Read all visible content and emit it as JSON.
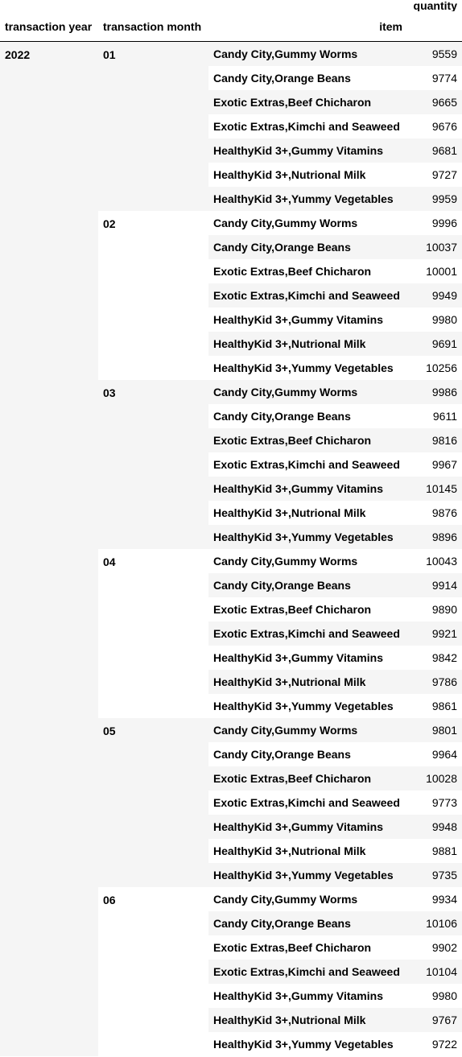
{
  "table": {
    "headers": {
      "transaction_year": "transaction year",
      "transaction_month": "transaction month",
      "item": "item",
      "quantity": "quantity"
    },
    "year": "2022",
    "months": [
      {
        "month": "01",
        "rows": [
          {
            "item": "Candy City,Gummy Worms",
            "quantity": "9559"
          },
          {
            "item": "Candy City,Orange Beans",
            "quantity": "9774"
          },
          {
            "item": "Exotic Extras,Beef Chicharon",
            "quantity": "9665"
          },
          {
            "item": "Exotic Extras,Kimchi and Seaweed",
            "quantity": "9676"
          },
          {
            "item": "HealthyKid 3+,Gummy Vitamins",
            "quantity": "9681"
          },
          {
            "item": "HealthyKid 3+,Nutrional Milk",
            "quantity": "9727"
          },
          {
            "item": "HealthyKid 3+,Yummy Vegetables",
            "quantity": "9959"
          }
        ]
      },
      {
        "month": "02",
        "rows": [
          {
            "item": "Candy City,Gummy Worms",
            "quantity": "9996"
          },
          {
            "item": "Candy City,Orange Beans",
            "quantity": "10037"
          },
          {
            "item": "Exotic Extras,Beef Chicharon",
            "quantity": "10001"
          },
          {
            "item": "Exotic Extras,Kimchi and Seaweed",
            "quantity": "9949"
          },
          {
            "item": "HealthyKid 3+,Gummy Vitamins",
            "quantity": "9980"
          },
          {
            "item": "HealthyKid 3+,Nutrional Milk",
            "quantity": "9691"
          },
          {
            "item": "HealthyKid 3+,Yummy Vegetables",
            "quantity": "10256"
          }
        ]
      },
      {
        "month": "03",
        "rows": [
          {
            "item": "Candy City,Gummy Worms",
            "quantity": "9986"
          },
          {
            "item": "Candy City,Orange Beans",
            "quantity": "9611"
          },
          {
            "item": "Exotic Extras,Beef Chicharon",
            "quantity": "9816"
          },
          {
            "item": "Exotic Extras,Kimchi and Seaweed",
            "quantity": "9967"
          },
          {
            "item": "HealthyKid 3+,Gummy Vitamins",
            "quantity": "10145"
          },
          {
            "item": "HealthyKid 3+,Nutrional Milk",
            "quantity": "9876"
          },
          {
            "item": "HealthyKid 3+,Yummy Vegetables",
            "quantity": "9896"
          }
        ]
      },
      {
        "month": "04",
        "rows": [
          {
            "item": "Candy City,Gummy Worms",
            "quantity": "10043"
          },
          {
            "item": "Candy City,Orange Beans",
            "quantity": "9914"
          },
          {
            "item": "Exotic Extras,Beef Chicharon",
            "quantity": "9890"
          },
          {
            "item": "Exotic Extras,Kimchi and Seaweed",
            "quantity": "9921"
          },
          {
            "item": "HealthyKid 3+,Gummy Vitamins",
            "quantity": "9842"
          },
          {
            "item": "HealthyKid 3+,Nutrional Milk",
            "quantity": "9786"
          },
          {
            "item": "HealthyKid 3+,Yummy Vegetables",
            "quantity": "9861"
          }
        ]
      },
      {
        "month": "05",
        "rows": [
          {
            "item": "Candy City,Gummy Worms",
            "quantity": "9801"
          },
          {
            "item": "Candy City,Orange Beans",
            "quantity": "9964"
          },
          {
            "item": "Exotic Extras,Beef Chicharon",
            "quantity": "10028"
          },
          {
            "item": "Exotic Extras,Kimchi and Seaweed",
            "quantity": "9773"
          },
          {
            "item": "HealthyKid 3+,Gummy Vitamins",
            "quantity": "9948"
          },
          {
            "item": "HealthyKid 3+,Nutrional Milk",
            "quantity": "9881"
          },
          {
            "item": "HealthyKid 3+,Yummy Vegetables",
            "quantity": "9735"
          }
        ]
      },
      {
        "month": "06",
        "rows": [
          {
            "item": "Candy City,Gummy Worms",
            "quantity": "9934"
          },
          {
            "item": "Candy City,Orange Beans",
            "quantity": "10106"
          },
          {
            "item": "Exotic Extras,Beef Chicharon",
            "quantity": "9902"
          },
          {
            "item": "Exotic Extras,Kimchi and Seaweed",
            "quantity": "10104"
          },
          {
            "item": "HealthyKid 3+,Gummy Vitamins",
            "quantity": "9980"
          },
          {
            "item": "HealthyKid 3+,Nutrional Milk",
            "quantity": "9767"
          },
          {
            "item": "HealthyKid 3+,Yummy Vegetables",
            "quantity": "9722"
          }
        ]
      }
    ]
  }
}
